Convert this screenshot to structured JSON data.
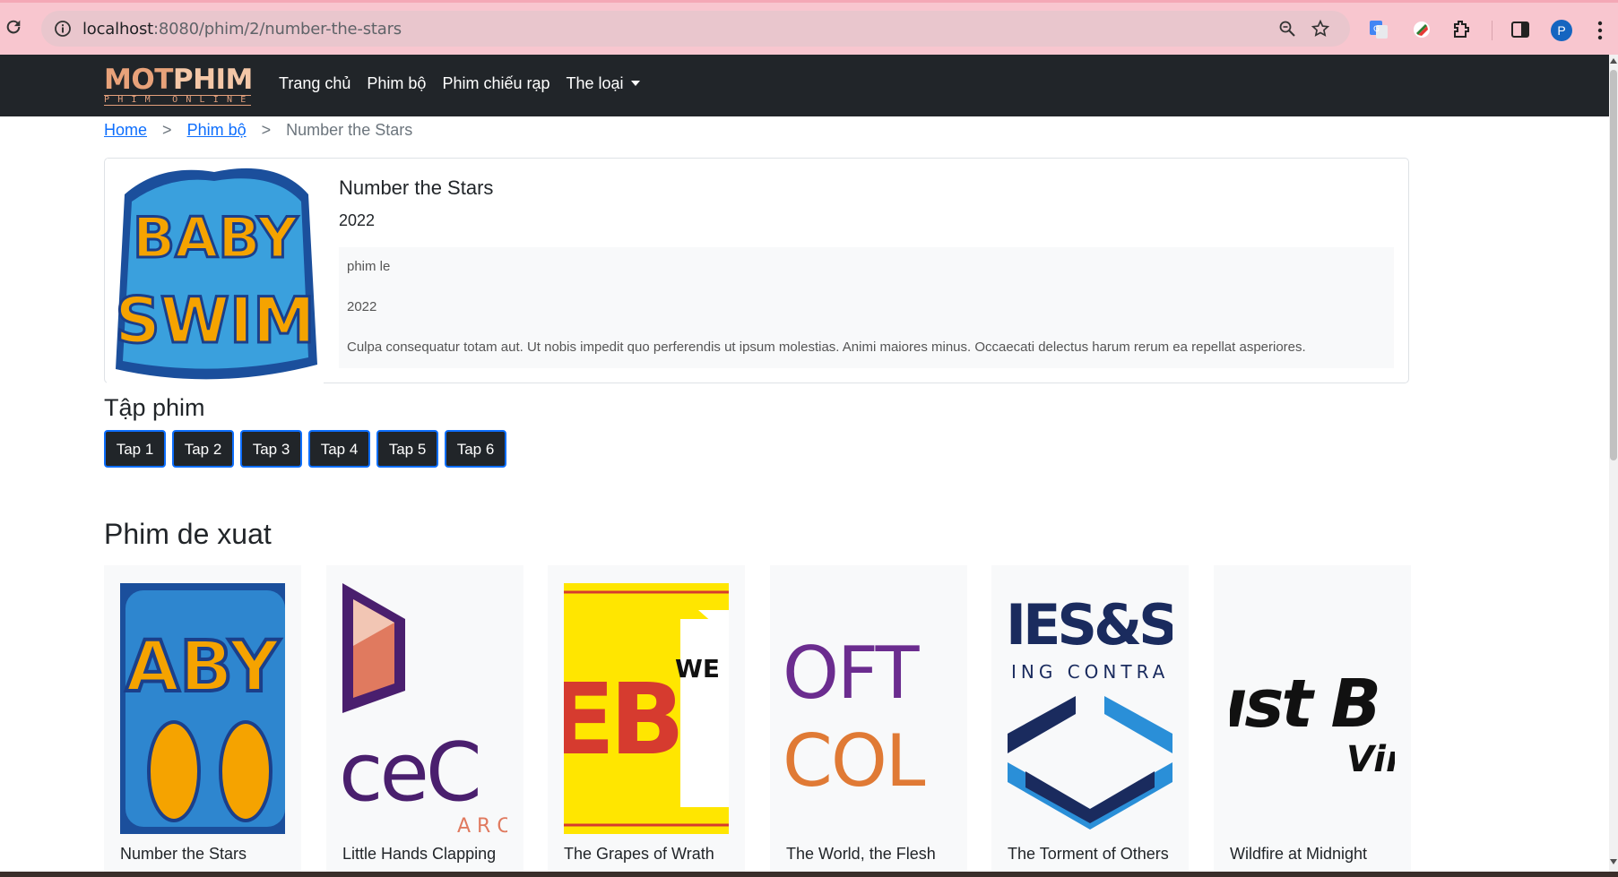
{
  "browser": {
    "url_host": "localhost",
    "url_rest": ":8080/phim/2/number-the-stars",
    "avatar_letter": "P"
  },
  "navbar": {
    "logo_main_a": "MOT",
    "logo_main_b": "PHIM",
    "logo_sub": "PHIM ONLINE",
    "links": [
      "Trang chủ",
      "Phim bộ",
      "Phim chiếu rạp",
      "The loại"
    ]
  },
  "breadcrumb": {
    "home": "Home",
    "sep": ">",
    "category": "Phim bộ",
    "current": "Number the Stars"
  },
  "movie": {
    "title": "Number the Stars",
    "year": "2022",
    "type": "phim le",
    "meta_year": "2022",
    "description": "Culpa consequatur totam aut. Ut nobis impedit quo perferendis ut ipsum molestias. Animi maiores minus. Occaecati delectus harum rerum ea repellat asperiores.",
    "poster_text_1": "BABY",
    "poster_text_2": "SWIM"
  },
  "episodes": {
    "heading": "Tập phim",
    "items": [
      "Tap 1",
      "Tap 2",
      "Tap 3",
      "Tap 4",
      "Tap 5",
      "Tap 6"
    ]
  },
  "suggested": {
    "heading": "Phim de xuat",
    "items": [
      {
        "name": "Number the Stars",
        "art": "ABY"
      },
      {
        "name": "Little Hands Clapping",
        "art": "ceC"
      },
      {
        "name": "The Grapes of Wrath",
        "art": "EB"
      },
      {
        "name": "The World, the Flesh",
        "art": "OFT"
      },
      {
        "name": "The Torment of Others",
        "art": "IES&SC"
      },
      {
        "name": "Wildfire at Midnight",
        "art": "ıst B"
      }
    ],
    "art_extra": {
      "arc": "A R C",
      "we": "WE",
      "col": "COL",
      "ing": "ING CONTRA",
      "vir": "Vir"
    }
  },
  "colors": {
    "navbar": "#212529",
    "link": "#0d6efd",
    "chrome": "#f8c6cf"
  }
}
